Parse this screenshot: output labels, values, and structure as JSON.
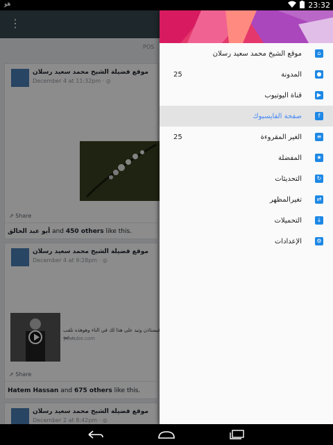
{
  "status_bar": {
    "left_text": "هو",
    "time": "23:32"
  },
  "app_bar": {
    "menu_icon": "overflow-menu-icon"
  },
  "feed": {
    "section_label": "POS",
    "posts": [
      {
        "author": "موقع فضيلة الشيخ محمد سعيد رسلان",
        "meta": "December 4 at 11:32pm · ◎",
        "share": "Share",
        "likes_name": "أبو عبد الخالق",
        "likes_and": " and ",
        "likes_count": "450 others",
        "likes_tail": " like this."
      },
      {
        "author": "موقع فضيلة الشيخ محمد سعيد رسلان",
        "meta": "December 4 at 9:28pm · ◎",
        "link_text": "فيستاذن وتيد على هذا لك في الناء وهوهذه تلقب عيد...",
        "link_src": "youtube.com",
        "share": "Share",
        "likes_name": "Hatem Hassan",
        "likes_and": " and ",
        "likes_count": "675 others",
        "likes_tail": " like this."
      },
      {
        "author": "موقع فضيلة الشيخ محمد سعيد رسلان",
        "meta": "December 2 at 8:42pm · ◎"
      }
    ]
  },
  "drawer": {
    "items": [
      {
        "label": "موقع الشيخ محمد سعيد رسلان",
        "icon": "home-icon",
        "count": ""
      },
      {
        "label": "المدونة",
        "icon": "blog-icon",
        "count": "25"
      },
      {
        "label": "قناة اليوتيوب",
        "icon": "youtube-icon",
        "count": ""
      },
      {
        "label": "صفحة الفايسبوك",
        "icon": "facebook-icon",
        "count": "",
        "active": true
      },
      {
        "label": "الغير المقروءة",
        "icon": "unread-icon",
        "count": "25"
      },
      {
        "label": "المفضلة",
        "icon": "star-icon",
        "count": ""
      },
      {
        "label": "التحديثات",
        "icon": "refresh-icon",
        "count": ""
      },
      {
        "label": "تغيرالمظهر",
        "icon": "theme-icon",
        "count": ""
      },
      {
        "label": "التحميلات",
        "icon": "download-icon",
        "count": ""
      },
      {
        "label": "الإعدادات",
        "icon": "settings-icon",
        "count": ""
      }
    ]
  },
  "colors": {
    "accent": "#1e88e5",
    "active_text": "#4285f4",
    "appbar": "#37474f",
    "header_pink": "#e4376b"
  }
}
